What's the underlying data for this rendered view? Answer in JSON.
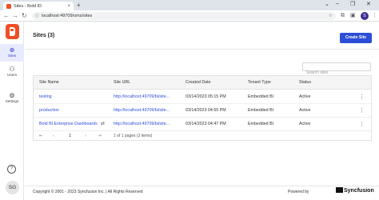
{
  "browser": {
    "tab_title": "Sites - Bold ID",
    "tab_close": "×",
    "new_tab": "+",
    "url": "localhost:49709/ums/sites",
    "profile_initial": "S",
    "window_controls": [
      "⌄",
      "–",
      "❐",
      "✕"
    ]
  },
  "sidebar": {
    "items": [
      {
        "label": "Sites",
        "icon": "globe-icon",
        "glyph": "⊕"
      },
      {
        "label": "Users",
        "icon": "users-icon",
        "glyph": "⚇"
      },
      {
        "label": "Settings",
        "icon": "gear-icon",
        "glyph": "⚙"
      }
    ],
    "help_glyph": "?",
    "avatar_initials": "SG"
  },
  "main": {
    "title": "Sites (3)",
    "create_button": "Create Site",
    "search_placeholder": "Search sites"
  },
  "table": {
    "columns": [
      "Site Name",
      "Site URL",
      "Created Date",
      "Tenant Type",
      "Status"
    ],
    "rows": [
      {
        "name": "testing",
        "url": "http://localhost:49709/bi/site...",
        "created": "03/14/2023 05:15 PM",
        "type": "Embedded BI",
        "status": "Active"
      },
      {
        "name": "production",
        "url": "http://localhost:49709/bi/site...",
        "created": "03/14/2023 04:55 PM",
        "type": "Embedded BI",
        "status": "Active"
      },
      {
        "name": "Bold BI Enterprise Dashboards",
        "url": "http://localhost:49709/bi/site...",
        "created": "03/14/2023 04:47 PM",
        "type": "Embedded BI",
        "status": "Active"
      }
    ],
    "pager": {
      "first": "⇤",
      "prev": "‹",
      "page": "1",
      "next": "›",
      "last": "⇥",
      "info": "1 of 1 pages (3 items)"
    }
  },
  "footer": {
    "copyright": "Copyright © 2001 - 2023 Syncfusion Inc. | All Rights Reserved",
    "powered_by": "Powered by",
    "brand": "Syncfusion"
  },
  "colors": {
    "accent": "#2c4fd8",
    "logo": "#f04e23",
    "active_nav_bg": "#e8ebfd"
  }
}
